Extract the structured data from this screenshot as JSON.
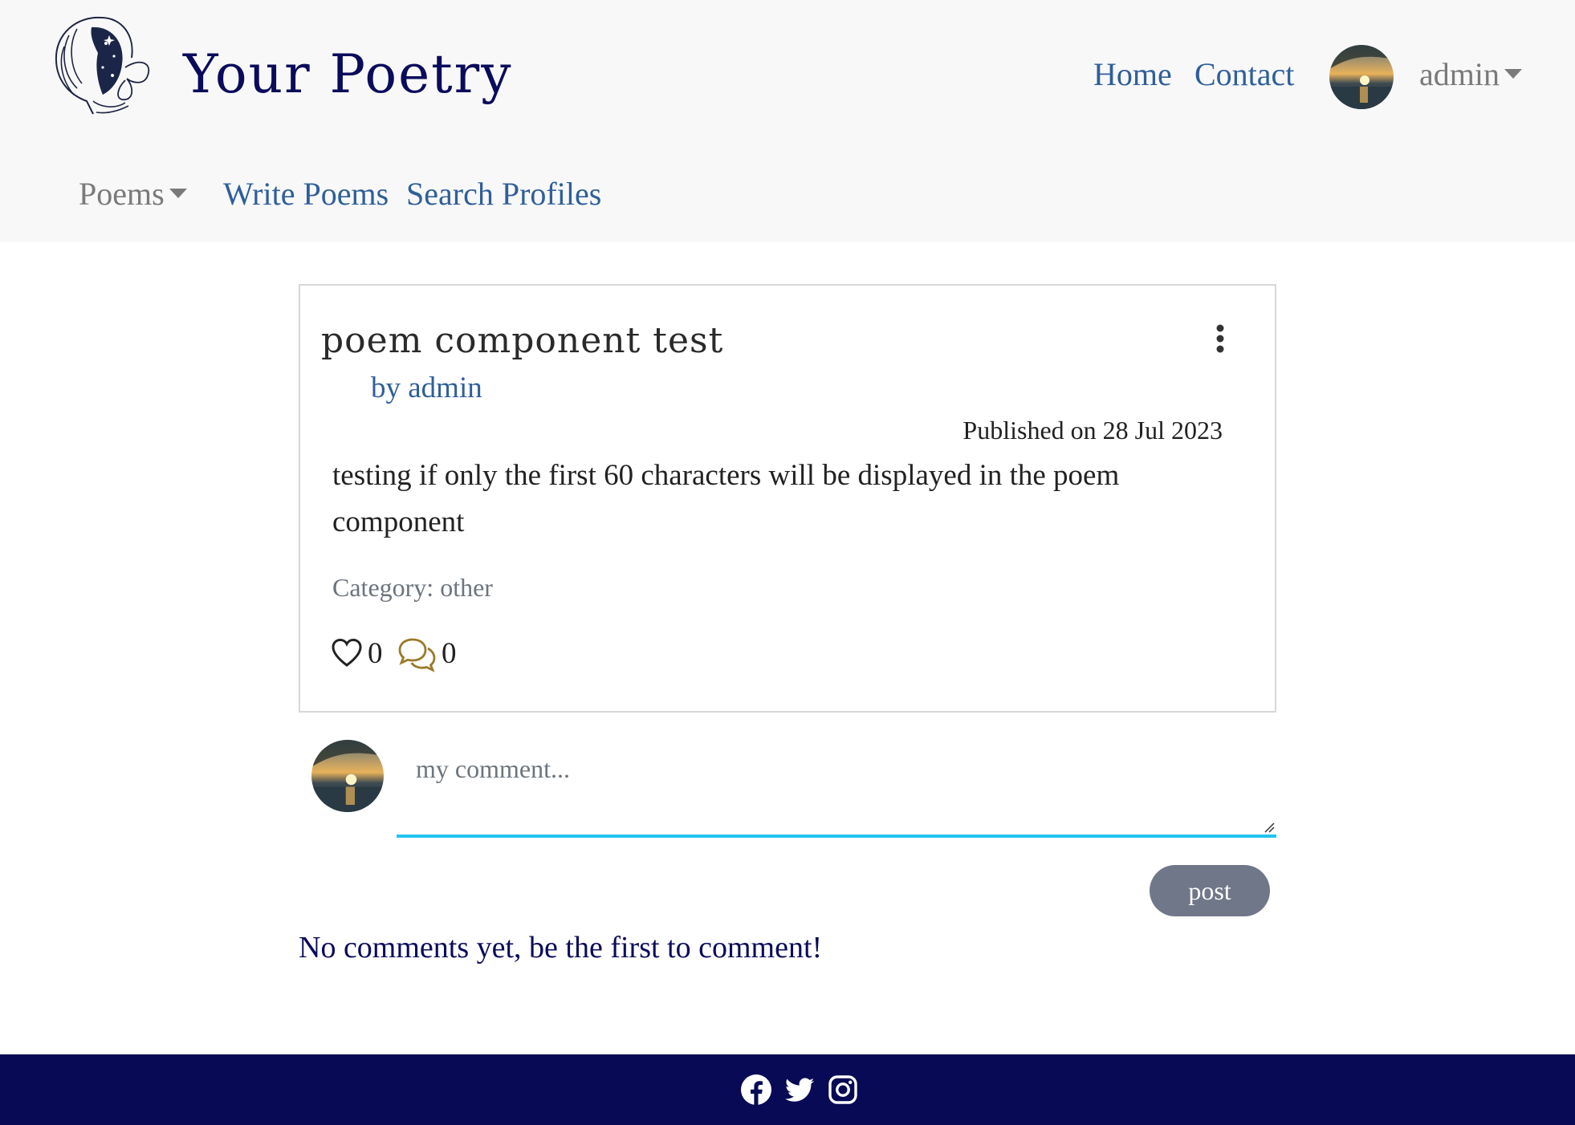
{
  "header": {
    "brand": "Your Poetry",
    "nav_links": [
      "Home",
      "Contact"
    ],
    "user": {
      "name": "admin"
    },
    "secondary_nav": [
      {
        "label": "Poems",
        "dropdown": true
      },
      {
        "label": "Write Poems",
        "dropdown": false
      },
      {
        "label": "Search Profiles",
        "dropdown": false
      }
    ]
  },
  "poem": {
    "title": "poem component test",
    "byline": "by admin",
    "published": "Published on 28 Jul 2023",
    "body": "testing if only the first 60 characters will be displayed in the poem component",
    "category": "Category: other",
    "likes": "0",
    "comments": "0"
  },
  "comment_form": {
    "placeholder": "my comment...",
    "submit_label": "post"
  },
  "comments": {
    "empty_message": "No comments yet, be the first to comment!"
  },
  "footer": {
    "social_icons": [
      "facebook-icon",
      "twitter-icon",
      "instagram-icon"
    ]
  },
  "colors": {
    "brand": "#0b0b5c",
    "link": "#2f5f9a",
    "muted": "#6c757d",
    "accent_underline": "#22c3ef",
    "footer_bg": "#080a55",
    "comment_icon": "#9a7a2a"
  }
}
